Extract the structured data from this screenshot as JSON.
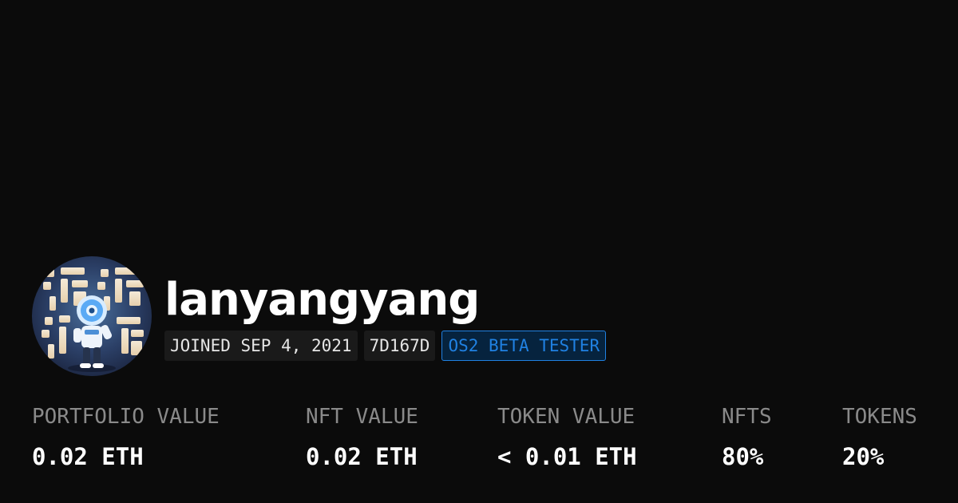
{
  "profile": {
    "username": "lanyangyang",
    "avatar_icon": "profile-avatar-image",
    "badges": {
      "joined": "JOINED SEP 4, 2021",
      "address": "7D167D",
      "beta": "OS2 BETA TESTER"
    }
  },
  "stats": [
    {
      "label": "PORTFOLIO VALUE",
      "value": "0.02 ETH"
    },
    {
      "label": "NFT VALUE",
      "value": "0.02 ETH"
    },
    {
      "label": "TOKEN VALUE",
      "value": "< 0.01 ETH"
    },
    {
      "label": "NFTS",
      "value": "80%"
    },
    {
      "label": "TOKENS",
      "value": "20%"
    }
  ],
  "colors": {
    "background": "#0b0b0b",
    "accent": "#2081e2",
    "muted_text": "#8a8a8a"
  }
}
